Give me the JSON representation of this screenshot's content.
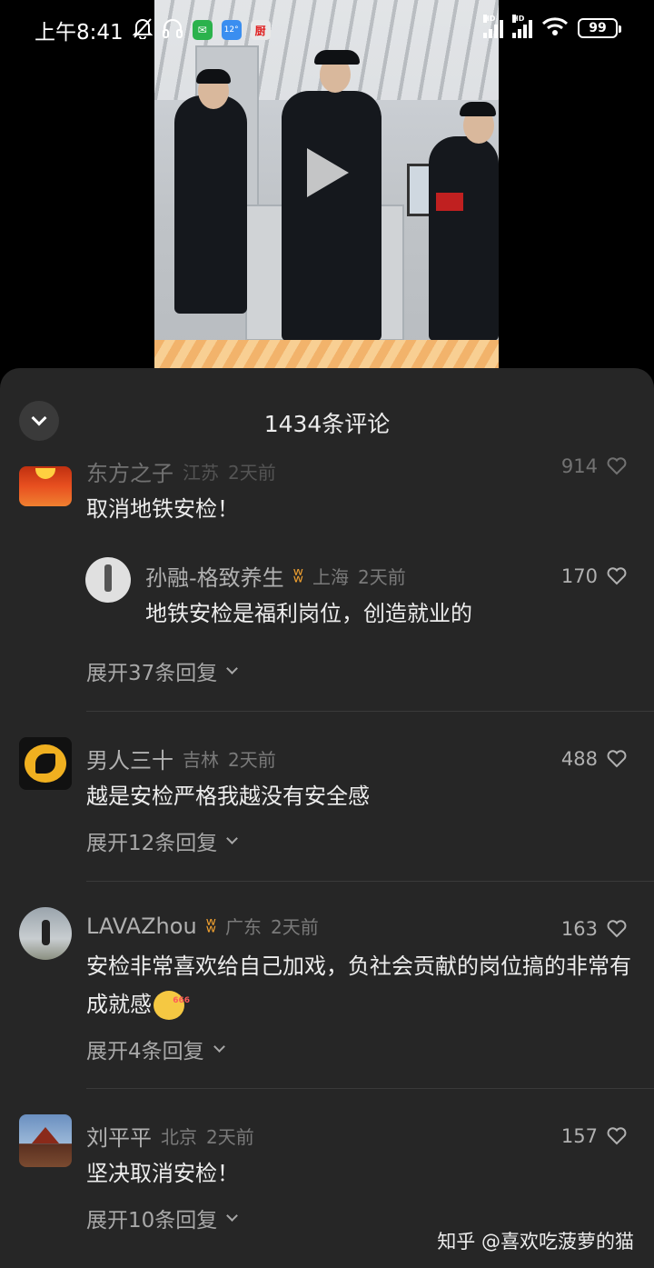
{
  "status_bar": {
    "time": "上午8:41",
    "app_icons": [
      "bell-off-icon",
      "headphones-icon",
      "wechat-icon",
      "weather-icon",
      "kitchen-app-icon"
    ],
    "weather_temp": "12°",
    "kitchen_char": "厨",
    "signal_label_1": "HD",
    "signal_label_2": "HD",
    "battery": "99"
  },
  "sheet": {
    "title": "1434条评论"
  },
  "comments": [
    {
      "user": "东方之子",
      "location": "江苏",
      "time": "2天前",
      "likes": "914",
      "text": "取消地铁安检！",
      "reply": {
        "user": "孙融-格致养生",
        "location": "上海",
        "time": "2天前",
        "likes": "170",
        "text": "地铁安检是福利岗位，创造就业的"
      },
      "expand": "展开37条回复"
    },
    {
      "user": "男人三十",
      "location": "吉林",
      "time": "2天前",
      "likes": "488",
      "text": "越是安检严格我越没有安全感",
      "expand": "展开12条回复"
    },
    {
      "user": "LAVAZhou",
      "location": "广东",
      "time": "2天前",
      "likes": "163",
      "text": "安检非常喜欢给自己加戏，负社会贡献的岗位搞的非常有成就感",
      "expand": "展开4条回复"
    },
    {
      "user": "刘平平",
      "location": "北京",
      "time": "2天前",
      "likes": "157",
      "text": "坚决取消安检！",
      "expand": "展开10条回复"
    }
  ],
  "watermark": "知乎 @喜欢吃菠萝的猫",
  "colors": {
    "sheet_bg": "#262626",
    "badge": "#f0a030",
    "text_primary": "#ececec",
    "text_secondary": "#b0b0b0"
  }
}
